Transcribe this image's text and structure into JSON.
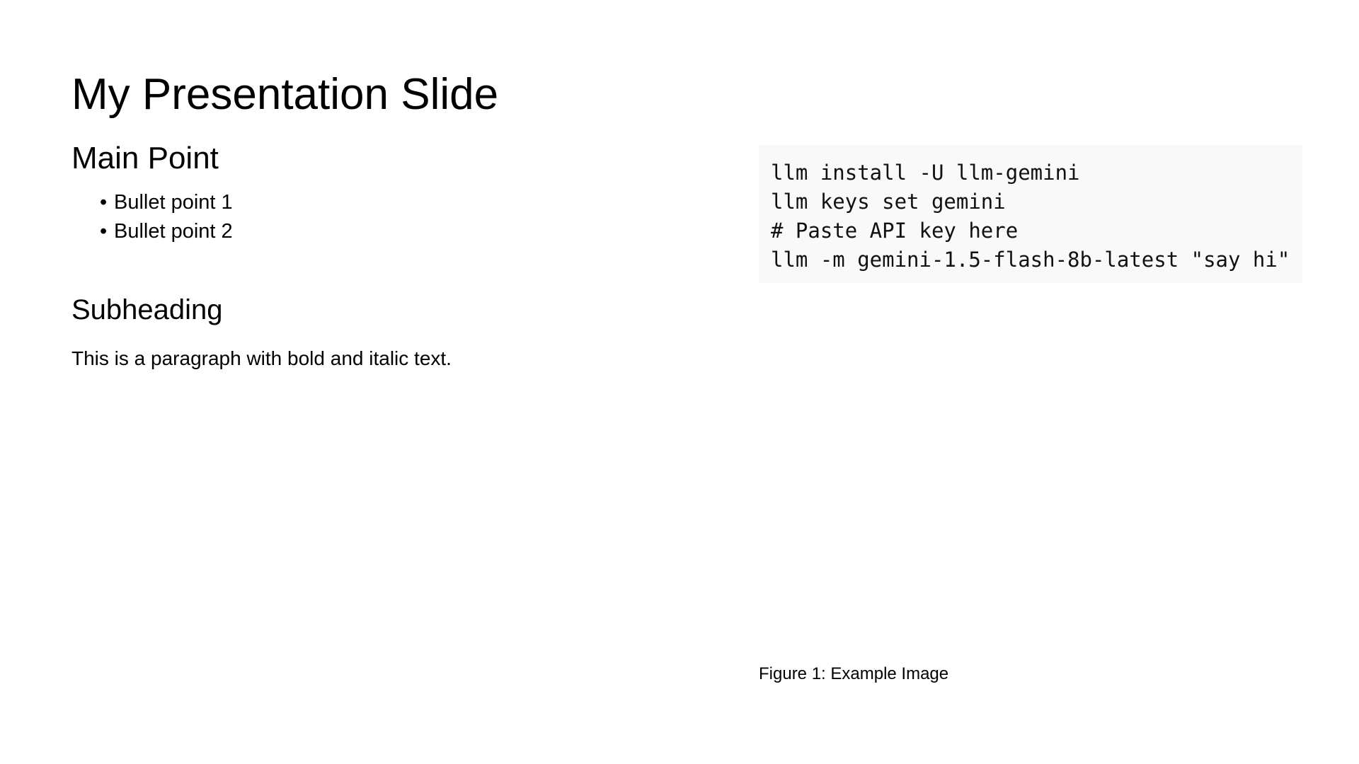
{
  "slide": {
    "title": "My Presentation Slide",
    "main_point": {
      "heading": "Main Point",
      "bullets": [
        "Bullet point 1",
        "Bullet point 2"
      ]
    },
    "subheading": "Subheading",
    "paragraph": "This is a paragraph with bold and italic text.",
    "code": {
      "lines": [
        "llm install -U llm-gemini",
        "llm keys set gemini",
        "# Paste API key here",
        "llm -m gemini-1.5-flash-8b-latest \"say hi\""
      ],
      "background_color": "#f9f9f9"
    },
    "figure_caption": "Figure 1: Example Image"
  }
}
